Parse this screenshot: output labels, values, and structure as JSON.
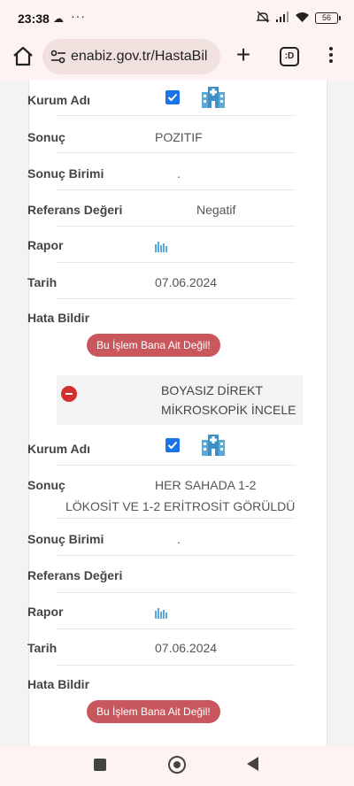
{
  "status_bar": {
    "time": "23:38",
    "dots": "···",
    "battery": "56"
  },
  "browser": {
    "url": "enabiz.gov.tr/HastaBil",
    "tab_label": ":D"
  },
  "results": [
    {
      "kurum_adi_label": "Kurum Adı",
      "sonuc_label": "Sonuç",
      "sonuc_value": "POZITIF",
      "sonuc_birimi_label": "Sonuç Birimi",
      "sonuc_birimi_value": ".",
      "referans_label": "Referans Değeri",
      "referans_value": "Negatif",
      "rapor_label": "Rapor",
      "tarih_label": "Tarih",
      "tarih_value": "07.06.2024",
      "hata_label": "Hata Bildir",
      "report_button": "Bu İşlem Bana Ait Değil!"
    },
    {
      "test_name_line1": "BOYASIZ DİREKT",
      "test_name_line2": "MİKROSKOPİK İNCELE",
      "kurum_adi_label": "Kurum Adı",
      "sonuc_label": "Sonuç",
      "sonuc_value_line1": "HER SAHADA 1-2",
      "sonuc_value_line2": "LÖKOSİT VE 1-2 ERİTROSİT GÖRÜLDÜ",
      "sonuc_birimi_label": "Sonuç Birimi",
      "sonuc_birimi_value": ".",
      "referans_label": "Referans Değeri",
      "rapor_label": "Rapor",
      "tarih_label": "Tarih",
      "tarih_value": "07.06.2024",
      "hata_label": "Hata Bildir",
      "report_button": "Bu İşlem Bana Ait Değil!"
    }
  ],
  "colors": {
    "accent_blue": "#1a73e8",
    "report_button": "#c9585e",
    "collapse_icon": "#d32f2f",
    "building_icon": "#5aa9d6"
  }
}
